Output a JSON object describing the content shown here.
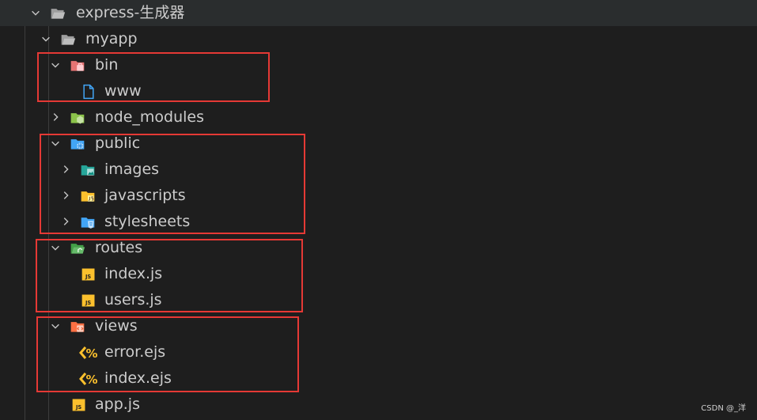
{
  "tree": [
    {
      "label": "express-生成器",
      "type": "folder",
      "icon": "folder-open-icon",
      "color": "#9e9e9e",
      "expanded": true
    },
    {
      "label": "myapp",
      "type": "folder",
      "icon": "folder-open-icon",
      "color": "#9e9e9e",
      "expanded": true
    },
    {
      "label": "bin",
      "type": "folder",
      "icon": "folder-bin-icon",
      "color": "#e57373",
      "expanded": true
    },
    {
      "label": "www",
      "type": "file",
      "icon": "file-icon",
      "color": "#42a5f5"
    },
    {
      "label": "node_modules",
      "type": "folder",
      "icon": "folder-node-icon",
      "color": "#8bc34a",
      "expanded": false
    },
    {
      "label": "public",
      "type": "folder",
      "icon": "folder-public-icon",
      "color": "#42a5f5",
      "expanded": true
    },
    {
      "label": "images",
      "type": "folder",
      "icon": "folder-images-icon",
      "color": "#26a69a",
      "expanded": false
    },
    {
      "label": "javascripts",
      "type": "folder",
      "icon": "folder-javascript-icon",
      "color": "#fbc02d",
      "expanded": false
    },
    {
      "label": "stylesheets",
      "type": "folder",
      "icon": "folder-css-icon",
      "color": "#42a5f5",
      "expanded": false
    },
    {
      "label": "routes",
      "type": "folder",
      "icon": "folder-routes-icon",
      "color": "#43a047",
      "expanded": true
    },
    {
      "label": "index.js",
      "type": "file",
      "icon": "javascript-file-icon",
      "color": "#fbc02d"
    },
    {
      "label": "users.js",
      "type": "file",
      "icon": "javascript-file-icon",
      "color": "#fbc02d"
    },
    {
      "label": "views",
      "type": "folder",
      "icon": "folder-views-icon",
      "color": "#ff7043",
      "expanded": true
    },
    {
      "label": "error.ejs",
      "type": "file",
      "icon": "ejs-file-icon",
      "color": "#fbc02d"
    },
    {
      "label": "index.ejs",
      "type": "file",
      "icon": "ejs-file-icon",
      "color": "#fbc02d"
    },
    {
      "label": "app.js",
      "type": "file",
      "icon": "javascript-file-icon",
      "color": "#fbc02d"
    }
  ],
  "js_badge": "JS",
  "highlight_color": "#e53935",
  "watermark": "CSDN @_洋"
}
